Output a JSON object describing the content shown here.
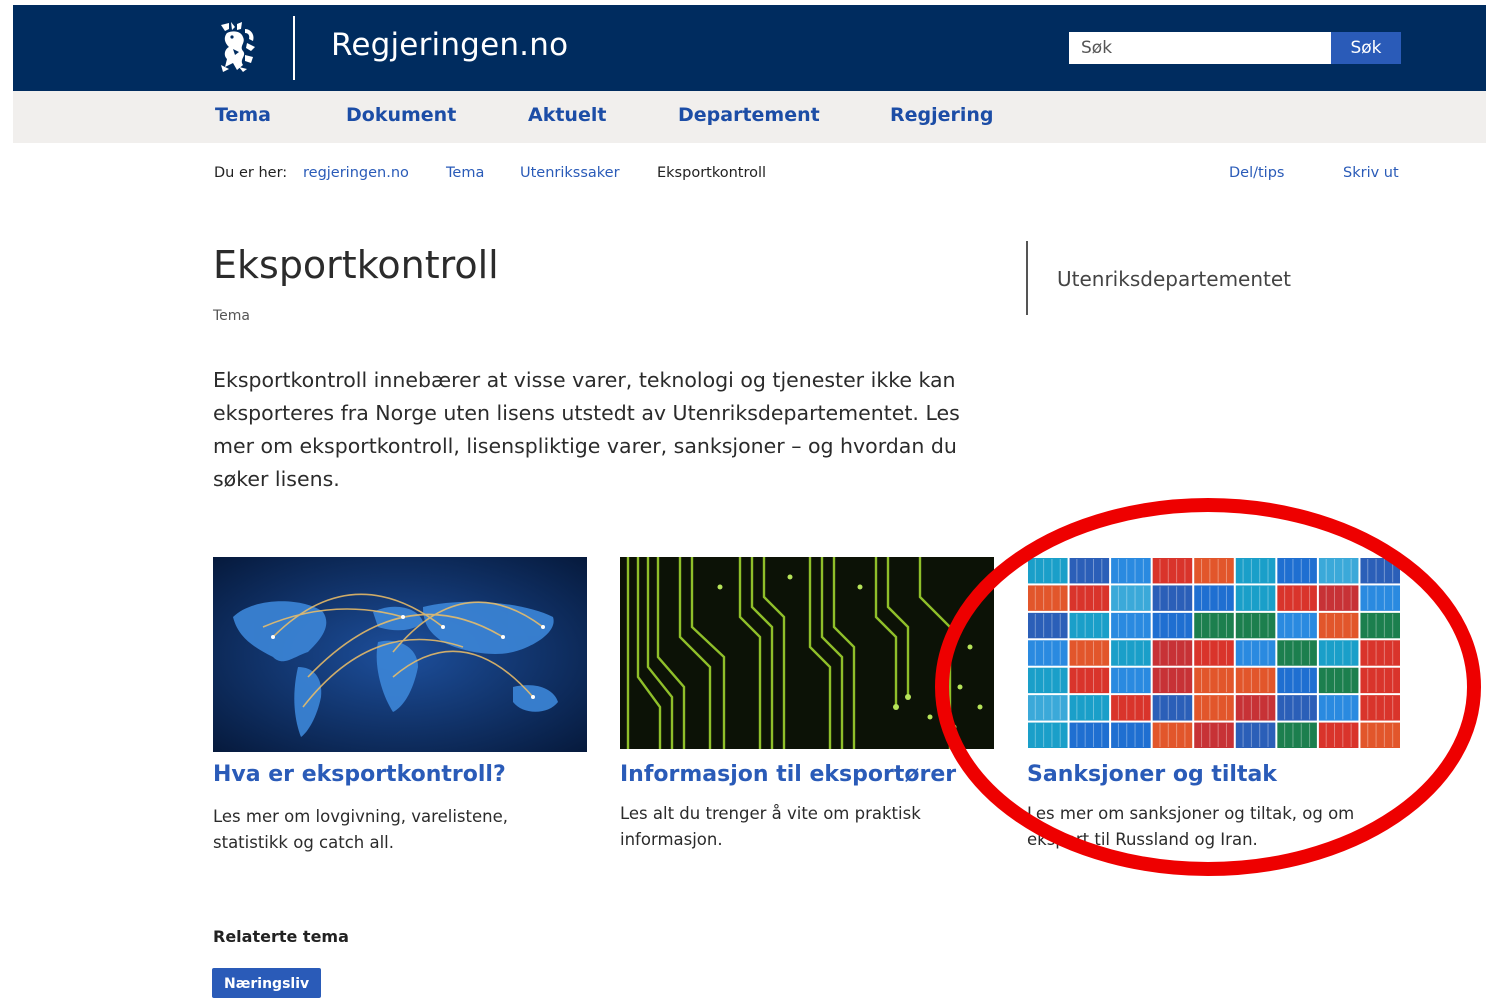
{
  "header": {
    "site_title": "Regjeringen.no",
    "logo_icon": "norwegian-lion-coat-of-arms-icon",
    "search_placeholder": "Søk",
    "search_button": "Søk",
    "colors": {
      "header_bg": "#002c5f",
      "nav_bg": "#f1efed",
      "link": "#2a5bb8"
    }
  },
  "nav": {
    "items": [
      {
        "label": "Tema"
      },
      {
        "label": "Dokument"
      },
      {
        "label": "Aktuelt"
      },
      {
        "label": "Departement"
      },
      {
        "label": "Regjering"
      }
    ]
  },
  "breadcrumb": {
    "prefix": "Du er her:",
    "links": [
      "regjeringen.no",
      "Tema",
      "Utenrikssaker"
    ],
    "current": "Eksportkontroll"
  },
  "tools": {
    "share": "Del/tips",
    "print": "Skriv ut"
  },
  "page": {
    "title": "Eksportkontroll",
    "type": "Tema",
    "owner": "Utenriksdepartementet",
    "intro": "Eksportkontroll innebærer at visse varer, teknologi og tjenester ikke kan eksporteres fra Norge uten lisens utstedt av Utenriksdepartementet. Les mer om eksportkontroll, lisenspliktige varer, sanksjoner – og hvordan du søker lisens."
  },
  "cards": [
    {
      "title": "Hva er eksportkontroll?",
      "text": "Les mer om lovgivning, varelistene, statistikk og catch all.",
      "image": "world-map-network-image"
    },
    {
      "title": "Informasjon til eksportører",
      "text": "Les alt du trenger å vite om praktisk informasjon.",
      "image": "circuit-board-image"
    },
    {
      "title": "Sanksjoner og tiltak",
      "text": "Les mer om sanksjoner og tiltak, og om eksport til Russland og Iran.",
      "image": "shipping-containers-image"
    }
  ],
  "related": {
    "heading": "Relaterte tema",
    "tags": [
      "Næringsliv"
    ]
  },
  "annotation": {
    "shape": "red-ellipse",
    "color": "#ee0000"
  }
}
